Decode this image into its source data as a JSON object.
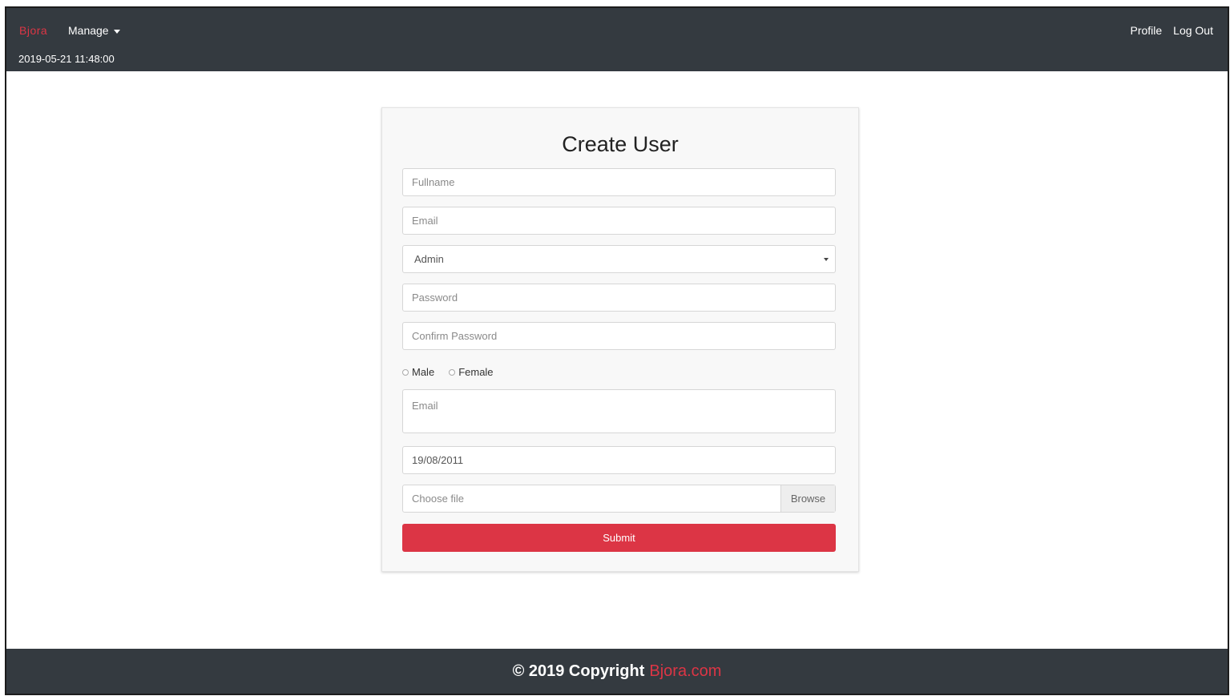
{
  "navbar": {
    "brand": "Bjora",
    "manage_label": "Manage",
    "datetime": "2019-05-21 11:48:00",
    "profile_label": "Profile",
    "logout_label": "Log Out"
  },
  "form": {
    "title": "Create User",
    "fullname_placeholder": "Fullname",
    "email_placeholder": "Email",
    "role_value": "Admin",
    "password_placeholder": "Password",
    "confirm_password_placeholder": "Confirm Password",
    "gender_options": [
      "Male",
      "Female"
    ],
    "address_placeholder": "Email",
    "dob_value": "19/08/2011",
    "file_placeholder": "Choose file",
    "browse_label": "Browse",
    "submit_label": "Submit"
  },
  "footer": {
    "copyright": "© 2019 Copyright",
    "site": "Bjora.com"
  },
  "colors": {
    "navbar_bg": "#343a40",
    "accent": "#dc3545"
  },
  "icons": {
    "caret": "chevron-down-icon"
  }
}
